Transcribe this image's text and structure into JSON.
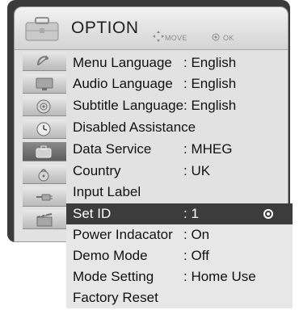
{
  "menu": {
    "title": "OPTION",
    "hint_move": "MOVE",
    "hint_ok": "OK",
    "hint_move_icon": "dpad-icon",
    "hint_ok_icon": "ok-circle-icon"
  },
  "sidebar": {
    "items": [
      {
        "icon": "satellite-dish-icon",
        "active": false
      },
      {
        "icon": "monitor-icon",
        "active": false
      },
      {
        "icon": "speaker-icon",
        "active": false
      },
      {
        "icon": "clock-icon",
        "active": false
      },
      {
        "icon": "toolbox-icon",
        "active": true
      },
      {
        "icon": "lock-icon",
        "active": false
      },
      {
        "icon": "input-plug-icon",
        "active": false
      },
      {
        "icon": "media-icon",
        "active": false
      }
    ]
  },
  "rows": [
    {
      "label": "Menu Language",
      "value": ": English"
    },
    {
      "label": "Audio Language",
      "value": ": English"
    },
    {
      "label": "Subtitle Language",
      "value": ": English"
    },
    {
      "label": "Disabled Assistance",
      "value": ""
    },
    {
      "label": "Data Service",
      "value": ": MHEG"
    },
    {
      "label": "Country",
      "value": ": UK"
    },
    {
      "label": "Input Label",
      "value": ""
    },
    {
      "label": "Set ID",
      "value": ": 1",
      "selected": true
    },
    {
      "label": "Power Indacator",
      "value": ": On"
    },
    {
      "label": "Demo Mode",
      "value": ": Off"
    },
    {
      "label": "Mode Setting",
      "value": ": Home Use"
    },
    {
      "label": "Factory Reset",
      "value": ""
    }
  ],
  "colors": {
    "selected_bg": "#3c3c3c",
    "menu_bg": "#e2e2e2",
    "frame": "#3a3a3a"
  }
}
